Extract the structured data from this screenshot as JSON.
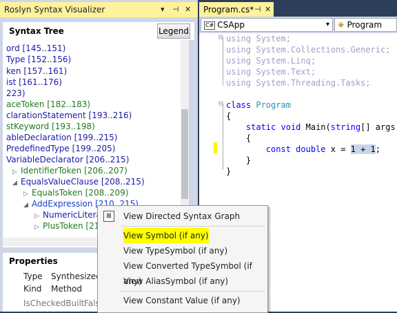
{
  "left_window": {
    "title": "Roslyn Syntax Visualizer",
    "title_icons": [
      "dropdown-icon",
      "pin-icon",
      "close-icon"
    ],
    "syntax_tree_header": "Syntax Tree",
    "legend_button": "Legend",
    "tree_items": [
      {
        "text": "ord [145..151)",
        "color": "blue"
      },
      {
        "text": "Type [152..156)",
        "color": "blue"
      },
      {
        "text": "ken [157..161)",
        "color": "blue"
      },
      {
        "text": "ist [161..176)",
        "color": "blue"
      },
      {
        "text": "223)",
        "color": "blue"
      },
      {
        "text": "aceToken [182..183)",
        "color": "green"
      },
      {
        "text": "clarationStatement [193..216)",
        "color": "blue"
      },
      {
        "text": "stKeyword [193..198)",
        "color": "green"
      },
      {
        "text": "ableDeclaration [199..215)",
        "color": "blue"
      },
      {
        "text": "PredefinedType [199..205)",
        "color": "blue"
      },
      {
        "text": "VariableDeclarator [206..215)",
        "color": "blue"
      },
      {
        "text": "IdentifierToken [206..207)",
        "color": "green"
      },
      {
        "text": "EqualsValueClause [208..215)",
        "color": "blue"
      },
      {
        "text": "EqualsToken [208..209)",
        "color": "green"
      },
      {
        "text": "AddExpression [210..215)",
        "color": "blue2"
      },
      {
        "text": "NumericLitera",
        "color": "blue"
      },
      {
        "text": "PlusToken [21",
        "color": "green"
      }
    ],
    "properties_header": "Properties",
    "properties": [
      {
        "key": "Type",
        "value": "SynthesizedIr"
      },
      {
        "key": "Kind",
        "value": "Method"
      },
      {
        "key": "IsCheckedBuilt",
        "value": "False"
      }
    ]
  },
  "editor": {
    "tab_title": "Program.cs*",
    "tab_icons": [
      "pin-icon",
      "close-icon"
    ],
    "nav_left": "CSApp",
    "nav_right": "Program",
    "code_lines": [
      {
        "text": "using System;"
      },
      {
        "text": "using System.Collections.Generic;"
      },
      {
        "text": "using System.Linq;"
      },
      {
        "text": "using System.Text;"
      },
      {
        "text": "using System.Threading.Tasks;"
      },
      {
        "text": ""
      },
      {
        "text": "class Program"
      },
      {
        "text": "{"
      },
      {
        "text": "    static void Main(string[] args)"
      },
      {
        "text": "    {"
      },
      {
        "text": "        const double x = 1 + 1;"
      },
      {
        "text": "    }"
      },
      {
        "text": "}"
      }
    ]
  },
  "context_menu": {
    "items": [
      {
        "label": "View Directed Syntax Graph",
        "highlighted": false
      },
      {
        "label": "View Symbol (if any)",
        "highlighted": true
      },
      {
        "label": "View TypeSymbol (if any)",
        "highlighted": false
      },
      {
        "label": "View Converted TypeSymbol (if any)",
        "highlighted": false
      },
      {
        "label": "View AliasSymbol (if any)",
        "highlighted": false
      },
      {
        "label": "View Constant Value (if any)",
        "highlighted": false
      }
    ]
  },
  "colors": {
    "active_title": "#fff29d",
    "background": "#2d3e5a",
    "panel": "#cfd6e5",
    "highlight": "#ffff00",
    "keyword": "#0000ff",
    "type": "#2b91af"
  }
}
